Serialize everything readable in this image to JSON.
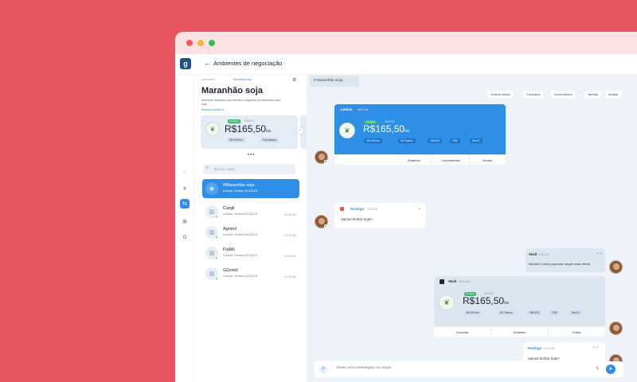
{
  "window": {
    "title": "Ambientes de negociação",
    "logo": "g",
    "back_icon": "arrow-left-icon"
  },
  "rail": {
    "items": [
      "home-icon",
      "group-icon",
      "exchange-icon",
      "box-icon",
      "gear-icon"
    ]
  },
  "left": {
    "breadcrumb_root": "Ambientes",
    "breadcrumb_current": "Maranhão soja",
    "title": "Maranhão soja",
    "description": "Ambiente dedicado aos clientes e negócios de Maranhão para soja",
    "more": "Mostrar detalhes",
    "product": {
      "badge": "Comprar",
      "code": "#000001",
      "price": "R$165,50",
      "unit": "/sc",
      "chips": [
        "300.000 ton",
        "Fob-Sampa"
      ]
    },
    "search_placeholder": "Buscar salas",
    "conversations": [
      {
        "name": "#Maranhão soja",
        "sub": "Letícia: Ordem #123123",
        "time": "",
        "selected": true
      },
      {
        "name": "Cargil",
        "sub": "Letícia: Ordem #123123",
        "time": "07:00 AM"
      },
      {
        "name": "Agrimil",
        "sub": "Letícia: Ordem #123123",
        "time": "07:00 AM"
      },
      {
        "name": "FlaMil",
        "sub": "Letícia: Ordem #123123",
        "time": "07:00 AM"
      },
      {
        "name": "GGrimil",
        "sub": "Letícia: Ordem #123123",
        "time": "07:00 AM"
      }
    ]
  },
  "chat": {
    "tab": "# Maranhão Soja",
    "filters": [
      "Ordens ativas",
      "Contratos",
      "Documentos",
      "Tarefas",
      "Auditar"
    ],
    "msg1": {
      "sender": "Letícia",
      "time": "08:00 AM",
      "badge": "Compra",
      "code": "#000003",
      "price": "R$165,50",
      "unit": "/sc",
      "chips": [
        "300.000 ton",
        "MT-Sorriso",
        "23/03/23",
        "FOB",
        "Rev.01"
      ],
      "actions": [
        "Detalhes",
        "Contraofertar",
        "Vender"
      ]
    },
    "msg2": {
      "sender": "Rodrigo",
      "time": "07:00 AM",
      "text": "Vamos fechar hoje?"
    },
    "msg3": {
      "sender": "Você",
      "time": "07:00 AM",
      "text": "Mandei a nova proposta, segue essa oferta"
    },
    "msg4": {
      "sender": "Você",
      "time": "08:00 AM",
      "badge": "Compra",
      "code": "#000003",
      "price": "R$165,50",
      "unit": "/sc",
      "chips": [
        "300.000 ton",
        "MT-Sorriso",
        "25/03/23",
        "FOB",
        "Rev.01"
      ],
      "actions": [
        "Cancelar",
        "Detalhes",
        "Editar"
      ]
    },
    "msg5": {
      "sender": "Rodrigo",
      "time": "07:00 AM",
      "text": "Vamos fechar hoje?"
    },
    "composer_placeholder": "Envie uma mensagem ou clique"
  }
}
